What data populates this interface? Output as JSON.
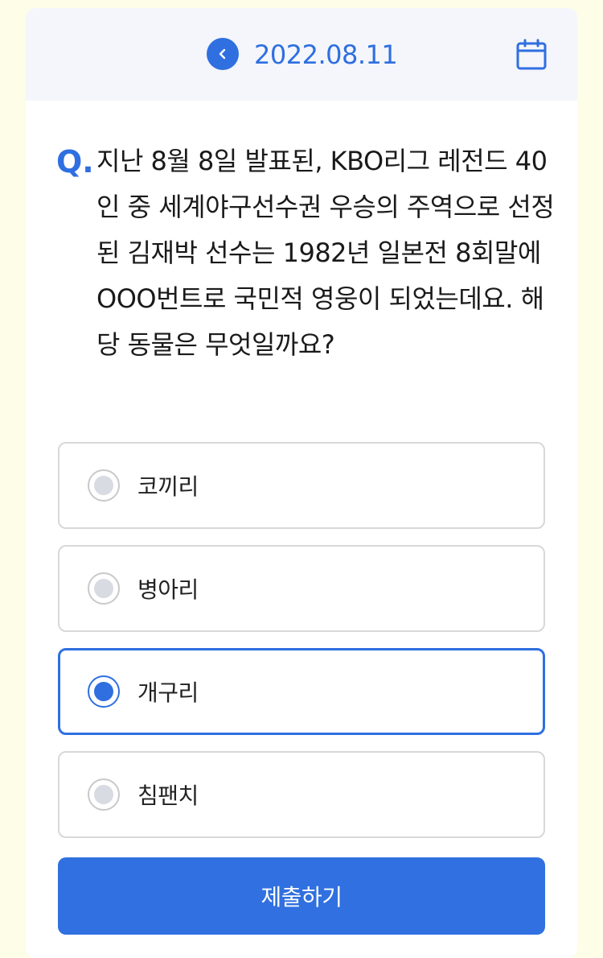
{
  "header": {
    "date": "2022.08.11",
    "back_icon": "chevron-left-icon",
    "calendar_icon": "calendar-icon"
  },
  "question": {
    "mark": "Q.",
    "text": "지난 8월 8일 발표된, KBO리그 레전드 40인 중 세계야구선수권 우승의 주역으로 선정된 김재박 선수는 1982년 일본전 8회말에 OOO번트로 국민적 영웅이 되었는데요. 해당 동물은 무엇일까요?"
  },
  "options": [
    {
      "label": "코끼리",
      "selected": false
    },
    {
      "label": "병아리",
      "selected": false
    },
    {
      "label": "개구리",
      "selected": true
    },
    {
      "label": "침팬치",
      "selected": false
    }
  ],
  "submit_label": "제출하기",
  "colors": {
    "accent": "#2f6fe0",
    "background": "#fdfde8",
    "header_bg": "#f4f6fb"
  }
}
